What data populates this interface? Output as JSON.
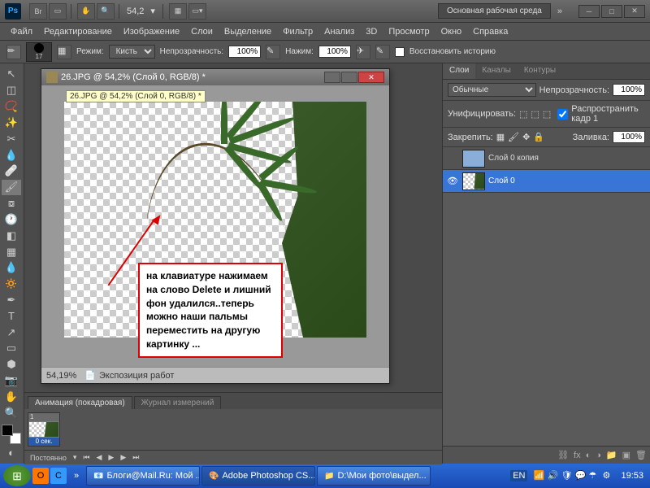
{
  "titlebar": {
    "zoom": "54,2",
    "workspace_label": "Основная рабочая среда"
  },
  "menu": {
    "file": "Файл",
    "edit": "Редактирование",
    "image": "Изображение",
    "layer": "Слои",
    "select": "Выделение",
    "filter": "Фильтр",
    "analysis": "Анализ",
    "view3d": "3D",
    "view": "Просмотр",
    "window": "Окно",
    "help": "Справка"
  },
  "options": {
    "brush_size": "17",
    "mode_label": "Режим:",
    "mode_value": "Кисть",
    "opacity_label": "Непрозрачность:",
    "opacity_value": "100%",
    "flow_label": "Нажим:",
    "flow_value": "100%",
    "restore_history": "Восстановить историю"
  },
  "document": {
    "title": "26.JPG @ 54,2% (Слой 0, RGB/8) *",
    "tooltip": "26.JPG @ 54,2% (Слой 0, RGB/8) *",
    "status_zoom": "54,19%",
    "status_info": "Экспозиция работ"
  },
  "annotation": {
    "text": "на клавиатуре нажимаем на слово Delete и лишний фон удалился..теперь можно наши пальмы переместить на другую картинку ..."
  },
  "animation": {
    "tab1": "Анимация (покадровая)",
    "tab2": "Журнал измерений",
    "frame_num": "1",
    "frame_time": "0 сек.",
    "loop": "Постоянно"
  },
  "layers_panel": {
    "tab_layers": "Слои",
    "tab_channels": "Каналы",
    "tab_paths": "Контуры",
    "blend_mode": "Обычные",
    "opacity_label": "Непрозрачность:",
    "opacity_value": "100%",
    "unify_label": "Унифицировать:",
    "propagate_label": "Распространить кадр 1",
    "lock_label": "Закрепить:",
    "fill_label": "Заливка:",
    "fill_value": "100%",
    "layer0_copy": "Слой 0 копия",
    "layer0": "Слой 0"
  },
  "taskbar": {
    "app1": "Блоги@Mail.Ru: Мой ...",
    "app2": "Adobe Photoshop CS...",
    "app3": "D:\\Мои фото\\выдел...",
    "lang": "EN",
    "time": "19:53"
  }
}
